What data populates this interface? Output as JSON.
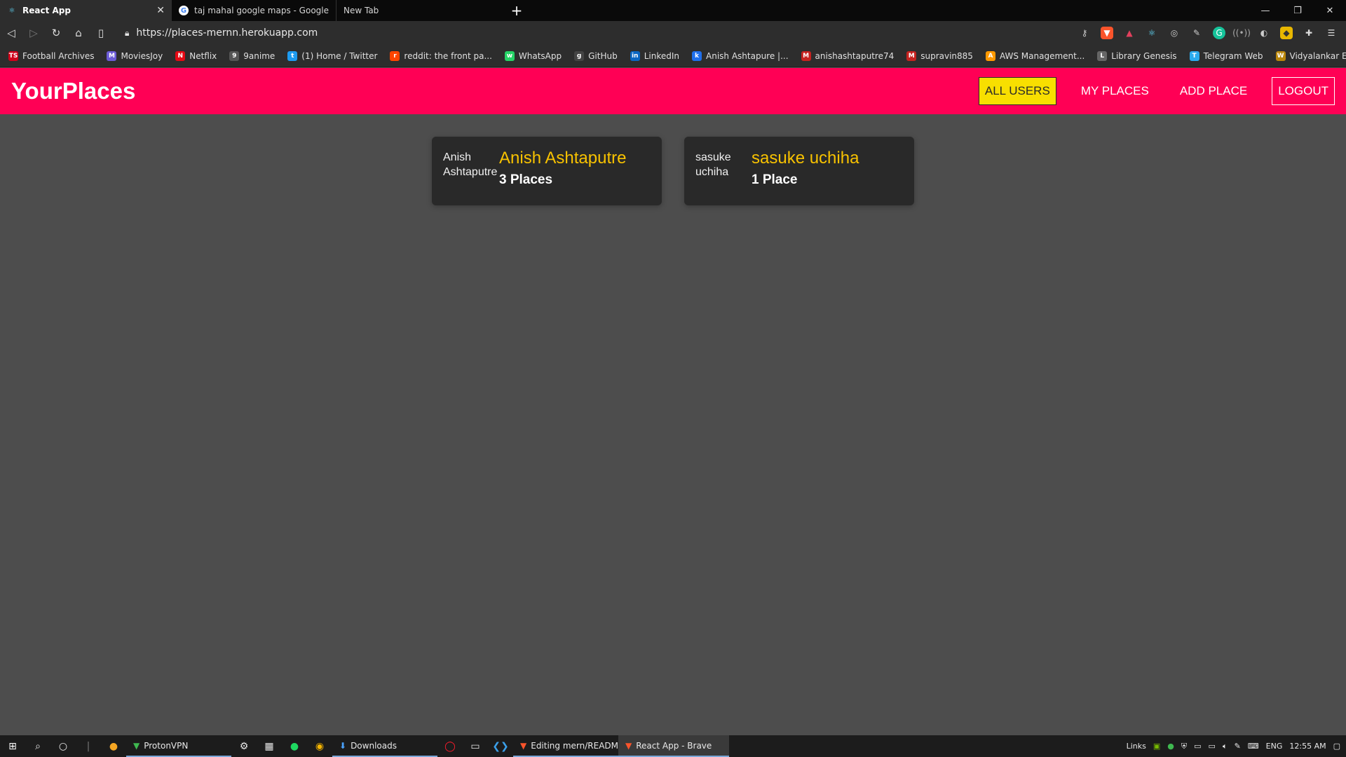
{
  "browser": {
    "tabs": [
      {
        "title": "React App",
        "active": true
      },
      {
        "title": "taj mahal google maps - Google Search",
        "active": false
      },
      {
        "title": "New Tab",
        "active": false
      }
    ],
    "new_tab_symbol": "+",
    "url": "https://places-mernn.herokuapp.com",
    "bookmarks": [
      {
        "label": "Football Archives",
        "icon": "TS",
        "color": "#d0021b"
      },
      {
        "label": "MoviesJoy",
        "icon": "M",
        "color": "#6b5bd6"
      },
      {
        "label": "Netflix",
        "icon": "N",
        "color": "#e50914"
      },
      {
        "label": "9anime",
        "icon": "9",
        "color": "#555555"
      },
      {
        "label": "(1) Home / Twitter",
        "icon": "t",
        "color": "#1d9bf0"
      },
      {
        "label": "reddit: the front pa...",
        "icon": "r",
        "color": "#ff4500"
      },
      {
        "label": "WhatsApp",
        "icon": "w",
        "color": "#25d366"
      },
      {
        "label": "GitHub",
        "icon": "g",
        "color": "#444444"
      },
      {
        "label": "LinkedIn",
        "icon": "in",
        "color": "#0a66c2"
      },
      {
        "label": "Anish Ashtapure |...",
        "icon": "k",
        "color": "#1f6feb"
      },
      {
        "label": "anishashtaputre74",
        "icon": "M",
        "color": "#c5221f"
      },
      {
        "label": "supravin885",
        "icon": "M",
        "color": "#c5221f"
      },
      {
        "label": "AWS Management...",
        "icon": "A",
        "color": "#ff9900"
      },
      {
        "label": "Library Genesis",
        "icon": "L",
        "color": "#666666"
      },
      {
        "label": "Telegram Web",
        "icon": "T",
        "color": "#2aabee"
      },
      {
        "label": "Vidyalankar ERP Sys...",
        "icon": "W",
        "color": "#b8860b"
      }
    ],
    "bookmarks_more": "»"
  },
  "app": {
    "title": "YourPlaces",
    "nav": {
      "all_users": "ALL USERS",
      "my_places": "MY PLACES",
      "add_place": "ADD PLACE",
      "logout": "LOGOUT"
    },
    "colors": {
      "header": "#ff0055",
      "active_nav": "#f8df00",
      "name": "#f8c200"
    },
    "users": [
      {
        "alt": "Anish Ashtaputre",
        "name": "Anish Ashtaputre",
        "places": "3 Places"
      },
      {
        "alt": "sasuke uchiha",
        "name": "sasuke uchiha",
        "places": "1 Place"
      }
    ]
  },
  "taskbar": {
    "apps": [
      {
        "label": "ProtonVPN",
        "state": "open"
      },
      {
        "label": "Downloads",
        "state": "open"
      },
      {
        "label": "Editing mern/READM...",
        "state": "open"
      },
      {
        "label": "React App - Brave",
        "state": "focused"
      }
    ],
    "tray": {
      "links": "Links",
      "lang": "ENG",
      "time": "12:55 AM"
    }
  }
}
